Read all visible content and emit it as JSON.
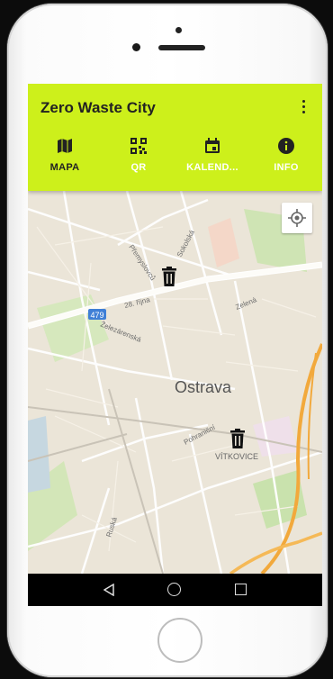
{
  "app": {
    "title": "Zero Waste City"
  },
  "tabs": [
    {
      "label": "MAPA",
      "icon": "map-icon"
    },
    {
      "label": "QR",
      "icon": "qr-code-icon"
    },
    {
      "label": "KALEND...",
      "icon": "calendar-icon"
    },
    {
      "label": "INFO",
      "icon": "info-icon"
    }
  ],
  "map": {
    "city_label": "Ostrava",
    "district_label": "VÍTKOVICE",
    "route_shield": "479",
    "streets": [
      "Přemyslovců",
      "Sokolská",
      "28. října",
      "Zelená",
      "Železárenská",
      "Pohraniční",
      "Ruská"
    ],
    "markers": [
      "trash-bin-icon",
      "trash-bin-icon"
    ]
  },
  "colors": {
    "accent": "#cdf01b",
    "inactive_tab_text": "#ffffff"
  }
}
